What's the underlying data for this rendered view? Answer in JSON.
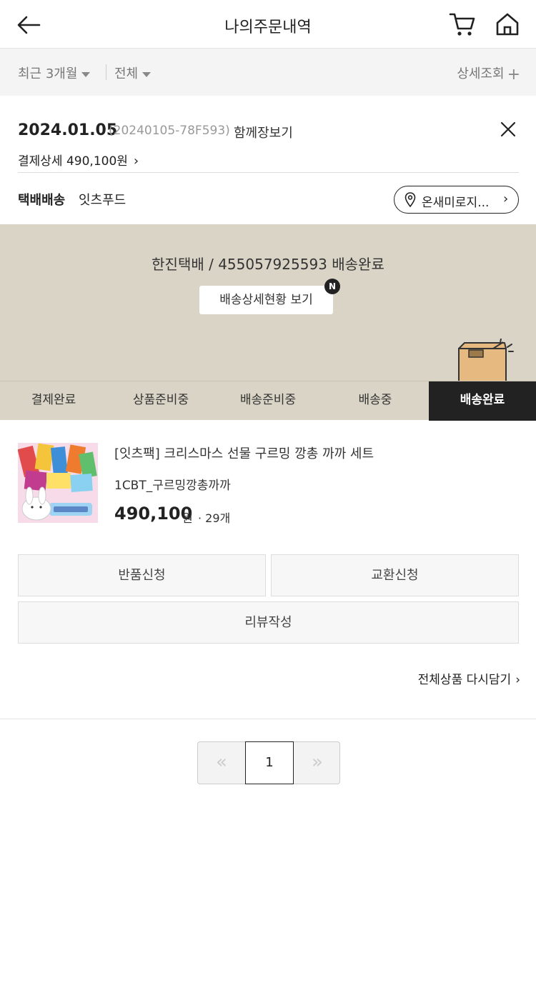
{
  "header": {
    "title": "나의주문내역"
  },
  "filter": {
    "period": "최근 3개월",
    "status": "전체",
    "detail": "상세조회"
  },
  "order": {
    "date": "2024.01.05",
    "number": "(20240105-78F593)",
    "channel": "함께장보기",
    "pay_detail": "결제상세 490,100원"
  },
  "shipping": {
    "type": "택배배송",
    "seller": "잇츠푸드",
    "store_button": "온새미로지..."
  },
  "tracking": {
    "text": "한진택배 / 455057925593 배송완료",
    "button": "배송상세현황 보기",
    "badge": "N"
  },
  "steps": [
    {
      "label": "결제완료"
    },
    {
      "label": "상품준비중"
    },
    {
      "label": "배송준비중"
    },
    {
      "label": "배송중"
    },
    {
      "label": "배송완료"
    }
  ],
  "active_step": "배송완료",
  "product": {
    "name": "[잇츠팩] 크리스마스 선물 구르밍 깡총 까까 세트",
    "option": "1CBT_구르밍깡총까까",
    "price": "490,100",
    "unit": "원",
    "qty": "· 29개"
  },
  "actions": {
    "return": "반품신청",
    "exchange": "교환신청",
    "review": "리뷰작성"
  },
  "readd": "전체상품 다시담기",
  "pager": {
    "prev": "«",
    "current": "1",
    "next": "»"
  },
  "colors": {
    "banner_bg": "#d9d4c6",
    "active_step_bg": "#222222"
  }
}
